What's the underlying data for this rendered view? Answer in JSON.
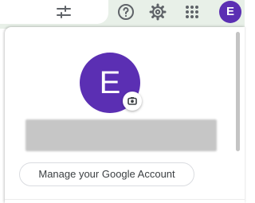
{
  "header": {
    "account_initial": "E",
    "icons": [
      "settings-sliders-icon",
      "help-icon",
      "gear-icon",
      "apps-grid-icon"
    ]
  },
  "account_panel": {
    "avatar_initial": "E",
    "camera_icon": "camera-icon",
    "display_name": "",
    "manage_account_label": "Manage your Google Account"
  },
  "colors": {
    "avatar_bg": "#5b2fb3",
    "topbar_bg": "#e8f0e8",
    "redaction": "#c6c6c6"
  }
}
